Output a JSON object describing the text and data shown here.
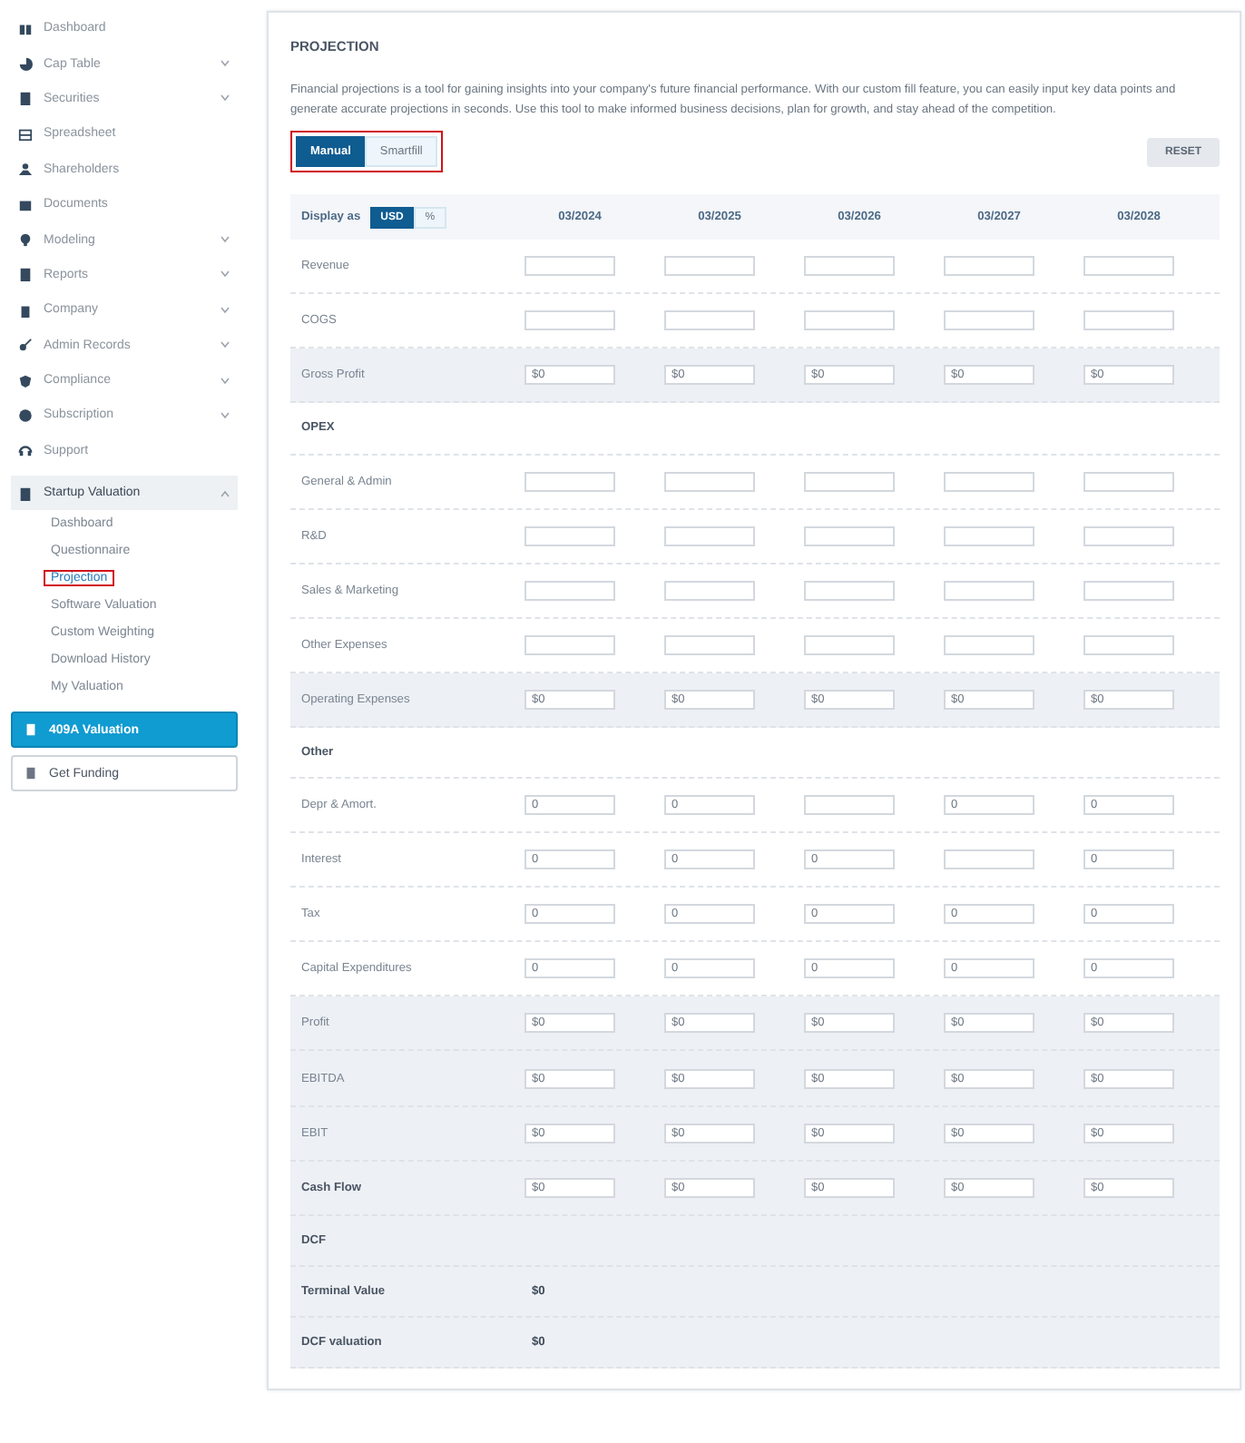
{
  "sidebar": {
    "items": [
      {
        "label": "Dashboard",
        "kind": "link"
      },
      {
        "label": "Cap Table",
        "kind": "menu"
      },
      {
        "label": "Securities",
        "kind": "menu"
      },
      {
        "label": "Spreadsheet",
        "kind": "link"
      },
      {
        "label": "Shareholders",
        "kind": "link"
      },
      {
        "label": "Documents",
        "kind": "link"
      },
      {
        "label": "Modeling",
        "kind": "menu"
      },
      {
        "label": "Reports",
        "kind": "menu"
      },
      {
        "label": "Company",
        "kind": "menu"
      },
      {
        "label": "Admin Records",
        "kind": "menu"
      },
      {
        "label": "Compliance",
        "kind": "menu"
      },
      {
        "label": "Subscription",
        "kind": "menu"
      },
      {
        "label": "Support",
        "kind": "link"
      }
    ],
    "group": {
      "label": "Startup Valuation",
      "expanded": true,
      "children": [
        {
          "label": "Dashboard",
          "selected": false
        },
        {
          "label": "Questionnaire",
          "selected": false
        },
        {
          "label": "Projection",
          "selected": true
        },
        {
          "label": "Software Valuation",
          "selected": false
        },
        {
          "label": "Custom Weighting",
          "selected": false
        },
        {
          "label": "Download History",
          "selected": false
        },
        {
          "label": "My Valuation",
          "selected": false
        }
      ]
    },
    "buttons": [
      {
        "label": "409A Valuation",
        "kind": "primary"
      },
      {
        "label": "Get Funding",
        "kind": "outline"
      }
    ]
  },
  "panel": {
    "title": "PROJECTION",
    "description": "Financial projections is a tool for gaining insights into your company's future financial performance. With our custom fill feature, you can easily input key data points and generate accurate projections in seconds. Use this tool to make informed business decisions, plan for growth, and stay ahead of the competition.",
    "mode_tabs": [
      {
        "label": "Manual",
        "selected": true
      },
      {
        "label": "Smartfill",
        "selected": false
      }
    ],
    "reset_button": "RESET",
    "display_label": "Display as",
    "display_options": [
      {
        "label": "USD",
        "selected": true
      },
      {
        "label": "%",
        "selected": false
      }
    ],
    "columns": [
      "03/2024",
      "03/2025",
      "03/2026",
      "03/2027",
      "03/2028"
    ],
    "rows": [
      {
        "label": "Revenue",
        "kind": "fields",
        "bold": false,
        "shaded": false,
        "cells": [
          {
            "filled": false
          },
          {
            "filled": false
          },
          {
            "filled": false
          },
          {
            "filled": false
          },
          {
            "filled": false
          }
        ]
      },
      {
        "label": "COGS",
        "kind": "fields",
        "bold": false,
        "shaded": false,
        "cells": [
          {
            "filled": false
          },
          {
            "filled": false
          },
          {
            "filled": false
          },
          {
            "filled": false
          },
          {
            "filled": false
          }
        ]
      },
      {
        "label": "Gross Profit",
        "kind": "fields",
        "bold": false,
        "shaded": true,
        "cells": [
          {
            "filled": true,
            "value": "$0"
          },
          {
            "filled": true,
            "value": "$0"
          },
          {
            "filled": true,
            "value": "$0"
          },
          {
            "filled": true,
            "value": "$0"
          },
          {
            "filled": true,
            "value": "$0"
          }
        ]
      },
      {
        "label": "OPEX",
        "kind": "heading",
        "bold": true,
        "shaded": false
      },
      {
        "label": "General & Admin",
        "kind": "fields",
        "bold": false,
        "shaded": false,
        "cells": [
          {
            "filled": false
          },
          {
            "filled": false
          },
          {
            "filled": false
          },
          {
            "filled": false
          },
          {
            "filled": false
          }
        ]
      },
      {
        "label": "R&D",
        "kind": "fields",
        "bold": false,
        "shaded": false,
        "cells": [
          {
            "filled": false
          },
          {
            "filled": false
          },
          {
            "filled": false
          },
          {
            "filled": false
          },
          {
            "filled": false
          }
        ]
      },
      {
        "label": "Sales & Marketing",
        "kind": "fields",
        "bold": false,
        "shaded": false,
        "cells": [
          {
            "filled": false
          },
          {
            "filled": false
          },
          {
            "filled": false
          },
          {
            "filled": false
          },
          {
            "filled": false
          }
        ]
      },
      {
        "label": "Other Expenses",
        "kind": "fields",
        "bold": false,
        "shaded": false,
        "cells": [
          {
            "filled": false
          },
          {
            "filled": false
          },
          {
            "filled": false
          },
          {
            "filled": false
          },
          {
            "filled": false
          }
        ]
      },
      {
        "label": "Operating Expenses",
        "kind": "fields",
        "bold": false,
        "shaded": true,
        "cells": [
          {
            "filled": true,
            "value": "$0"
          },
          {
            "filled": true,
            "value": "$0"
          },
          {
            "filled": true,
            "value": "$0"
          },
          {
            "filled": true,
            "value": "$0"
          },
          {
            "filled": true,
            "value": "$0"
          }
        ]
      },
      {
        "label": "Other",
        "kind": "heading",
        "bold": true,
        "shaded": false
      },
      {
        "label": "Depr & Amort.",
        "kind": "fields",
        "bold": false,
        "shaded": false,
        "cells": [
          {
            "filled": true,
            "value": "0"
          },
          {
            "filled": true,
            "value": "0"
          },
          {
            "filled": false
          },
          {
            "filled": true,
            "value": "0"
          },
          {
            "filled": true,
            "value": "0"
          }
        ]
      },
      {
        "label": "Interest",
        "kind": "fields",
        "bold": false,
        "shaded": false,
        "cells": [
          {
            "filled": true,
            "value": "0"
          },
          {
            "filled": true,
            "value": "0"
          },
          {
            "filled": true,
            "value": "0"
          },
          {
            "filled": false
          },
          {
            "filled": true,
            "value": "0"
          }
        ]
      },
      {
        "label": "Tax",
        "kind": "fields",
        "bold": false,
        "shaded": false,
        "cells": [
          {
            "filled": true,
            "value": "0"
          },
          {
            "filled": true,
            "value": "0"
          },
          {
            "filled": true,
            "value": "0"
          },
          {
            "filled": true,
            "value": "0"
          },
          {
            "filled": true,
            "value": "0"
          }
        ]
      },
      {
        "label": "Capital Expenditures",
        "kind": "fields",
        "bold": false,
        "shaded": false,
        "cells": [
          {
            "filled": true,
            "value": "0"
          },
          {
            "filled": true,
            "value": "0"
          },
          {
            "filled": true,
            "value": "0"
          },
          {
            "filled": true,
            "value": "0"
          },
          {
            "filled": true,
            "value": "0"
          }
        ]
      },
      {
        "label": "Profit",
        "kind": "fields",
        "bold": false,
        "shaded": true,
        "cells": [
          {
            "filled": true,
            "value": "$0"
          },
          {
            "filled": true,
            "value": "$0"
          },
          {
            "filled": true,
            "value": "$0"
          },
          {
            "filled": true,
            "value": "$0"
          },
          {
            "filled": true,
            "value": "$0"
          }
        ]
      },
      {
        "label": "EBITDA",
        "kind": "fields",
        "bold": false,
        "shaded": true,
        "cells": [
          {
            "filled": true,
            "value": "$0"
          },
          {
            "filled": true,
            "value": "$0"
          },
          {
            "filled": true,
            "value": "$0"
          },
          {
            "filled": true,
            "value": "$0"
          },
          {
            "filled": true,
            "value": "$0"
          }
        ]
      },
      {
        "label": "EBIT",
        "kind": "fields",
        "bold": false,
        "shaded": true,
        "cells": [
          {
            "filled": true,
            "value": "$0"
          },
          {
            "filled": true,
            "value": "$0"
          },
          {
            "filled": true,
            "value": "$0"
          },
          {
            "filled": true,
            "value": "$0"
          },
          {
            "filled": true,
            "value": "$0"
          }
        ]
      },
      {
        "label": "Cash Flow",
        "kind": "fields",
        "bold": true,
        "shaded": true,
        "cells": [
          {
            "filled": true,
            "value": "$0"
          },
          {
            "filled": true,
            "value": "$0"
          },
          {
            "filled": true,
            "value": "$0"
          },
          {
            "filled": true,
            "value": "$0"
          },
          {
            "filled": true,
            "value": "$0"
          }
        ]
      },
      {
        "label": "DCF",
        "kind": "heading",
        "bold": true,
        "shaded": true
      },
      {
        "label": "Terminal Value",
        "kind": "total",
        "bold": true,
        "shaded": true,
        "value": "$0"
      },
      {
        "label": "DCF valuation",
        "kind": "total",
        "bold": true,
        "shaded": true,
        "value": "$0"
      }
    ]
  }
}
